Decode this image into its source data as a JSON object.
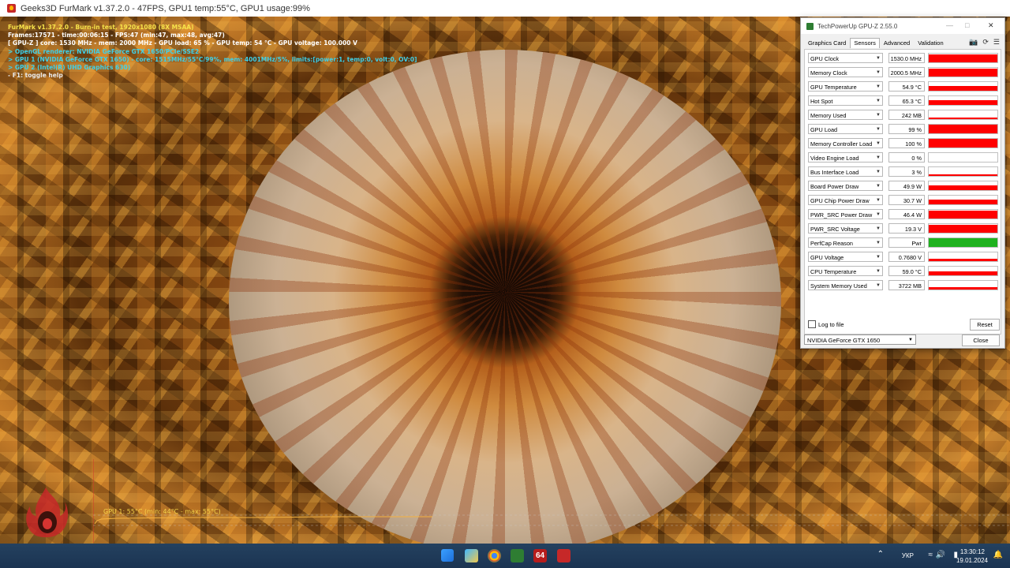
{
  "furmark": {
    "window_title": "Geeks3D FurMark v1.37.2.0 - 47FPS, GPU1 temp:55°C, GPU1 usage:99%",
    "overlay": [
      {
        "text": "FurMark v1.37.2.0 - Burn-in test, 1920x1080 (8X MSAA)",
        "color": "yellow"
      },
      {
        "text": "Frames:17571 - time:00:06:15 - FPS:47 (min:47, max:48, avg:47)",
        "color": "white"
      },
      {
        "text": "[ GPU-Z ] core: 1530 MHz - mem: 2000 MHz - GPU load: 65 % - GPU temp: 54 °C - GPU voltage: 100.000 V",
        "color": "white"
      },
      {
        "text": "> OpenGL renderer: NVIDIA GeForce GTX 1650/PCIe/SSE2",
        "color": "cyan"
      },
      {
        "text": "> GPU 1 (NVIDIA GeForce GTX 1650) - core: 1515MHz/55°C/99%, mem: 4001MHz/5%, limits:[power:1, temp:0, volt:0, OV:0]",
        "color": "cyan"
      },
      {
        "text": "> GPU 2 (Intel(R) UHD Graphics 630)",
        "color": "cyan"
      },
      {
        "text": "- F1: toggle help",
        "color": "light"
      }
    ],
    "graph_label": "GPU 1: 55°C (min: 44°C - max: 55°C)"
  },
  "gpuz": {
    "title": "TechPowerUp GPU-Z 2.55.0",
    "tabs": [
      "Graphics Card",
      "Sensors",
      "Advanced",
      "Validation"
    ],
    "active_tab": "Sensors",
    "sensors": [
      {
        "name": "GPU Clock",
        "value": "1530.0 MHz",
        "level": 0.95,
        "color": "#ff0000"
      },
      {
        "name": "Memory Clock",
        "value": "2000.5 MHz",
        "level": 0.95,
        "color": "#ff0000"
      },
      {
        "name": "GPU Temperature",
        "value": "54.9 °C",
        "level": 0.55,
        "color": "#ff0000"
      },
      {
        "name": "Hot Spot",
        "value": "65.3 °C",
        "level": 0.55,
        "color": "#ff0000"
      },
      {
        "name": "Memory Used",
        "value": "242 MB",
        "level": 0.1,
        "color": "#ff0000"
      },
      {
        "name": "GPU Load",
        "value": "99 %",
        "level": 0.99,
        "color": "#ff0000"
      },
      {
        "name": "Memory Controller Load",
        "value": "100 %",
        "level": 1.0,
        "color": "#ff0000"
      },
      {
        "name": "Video Engine Load",
        "value": "0 %",
        "level": 0.0,
        "color": "#ff0000"
      },
      {
        "name": "Bus Interface Load",
        "value": "3 %",
        "level": 0.05,
        "color": "#ff0000"
      },
      {
        "name": "Board Power Draw",
        "value": "49.9 W",
        "level": 0.5,
        "color": "#ff0000"
      },
      {
        "name": "GPU Chip Power Draw",
        "value": "30.7 W",
        "level": 0.5,
        "color": "#ff0000"
      },
      {
        "name": "PWR_SRC Power Draw",
        "value": "46.4 W",
        "level": 0.9,
        "color": "#ff0000"
      },
      {
        "name": "PWR_SRC Voltage",
        "value": "19.3 V",
        "level": 0.95,
        "color": "#ff0000"
      },
      {
        "name": "PerfCap Reason",
        "value": "Pwr",
        "level": 1.0,
        "color": "#1fb21f"
      },
      {
        "name": "GPU Voltage",
        "value": "0.7680 V",
        "level": 0.3,
        "color": "#ff0000"
      },
      {
        "name": "CPU Temperature",
        "value": "59.0 °C",
        "level": 0.45,
        "color": "#ff0000"
      },
      {
        "name": "System Memory Used",
        "value": "3722 MB",
        "level": 0.3,
        "color": "#ff0000"
      }
    ],
    "log_label": "Log to file",
    "reset_label": "Reset",
    "gpu_select": "NVIDIA GeForce GTX 1650",
    "close_label": "Close"
  },
  "taskbar": {
    "badge": "64",
    "language": "УКР",
    "time": "13:30:12",
    "date": "19.01.2024"
  }
}
